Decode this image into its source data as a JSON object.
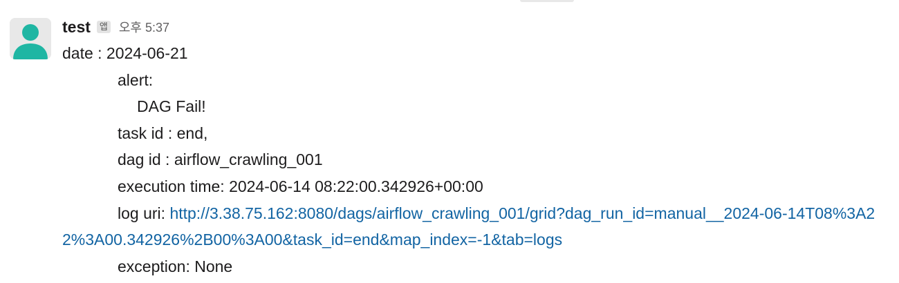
{
  "message": {
    "sender": "test",
    "app_badge": "앱",
    "timestamp": "오후 5:37",
    "avatar_icon": "user-avatar-icon",
    "avatar_color": "#1fb6a3",
    "link_color": "#1264a3",
    "lines": {
      "date": "date : 2024-06-21",
      "alert_label": "alert:",
      "alert_message": "DAG Fail!",
      "task_id": "task id : end,",
      "dag_id": "dag id : airflow_crawling_001",
      "execution_time": "execution time: 2024-06-14 08:22:00.342926+00:00",
      "log_uri_label": "log uri: ",
      "log_uri": "http://3.38.75.162:8080/dags/airflow_crawling_001/grid?dag_run_id=manual__2024-06-14T08%3A22%3A00.342926%2B00%3A00&task_id=end&map_index=-1&tab=logs",
      "exception": "exception: None"
    }
  }
}
